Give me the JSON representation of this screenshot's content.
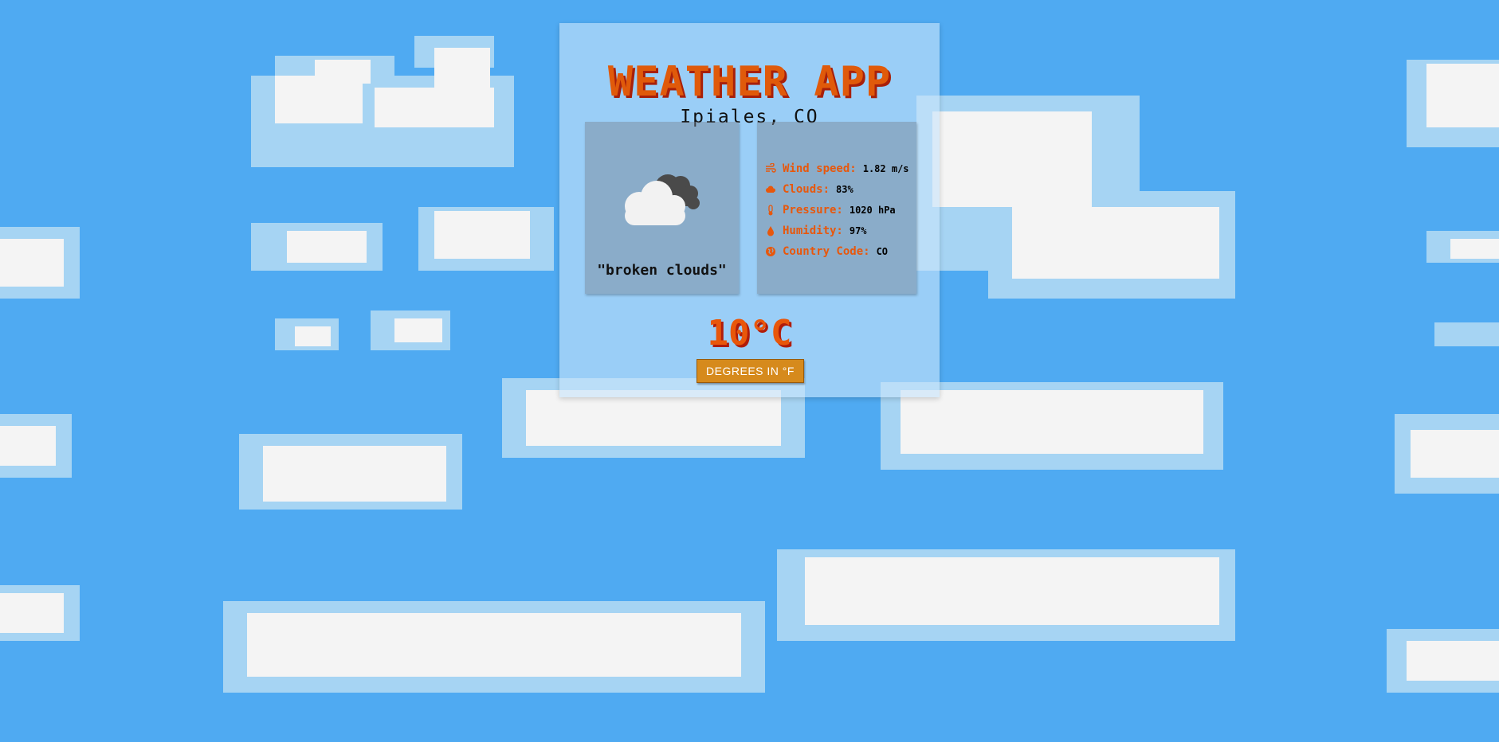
{
  "app": {
    "title": "WEATHER APP",
    "location": "Ipiales, CO"
  },
  "weather": {
    "description": "\"broken clouds\"",
    "icon": "broken-clouds-icon"
  },
  "stats": [
    {
      "icon": "wind-icon",
      "label": "Wind speed:",
      "value": "1.82 m/s"
    },
    {
      "icon": "cloud-icon",
      "label": "Clouds:",
      "value": "83%"
    },
    {
      "icon": "thermometer-icon",
      "label": "Pressure:",
      "value": "1020 hPa"
    },
    {
      "icon": "droplet-icon",
      "label": "Humidity:",
      "value": "97%"
    },
    {
      "icon": "globe-icon",
      "label": "Country Code:",
      "value": "CO"
    }
  ],
  "temperature": {
    "value": "10°C"
  },
  "toggle": {
    "label": "DEGREES IN °F"
  },
  "colors": {
    "sky": "#4faaf2",
    "accent": "#e8570b",
    "button": "#d68a1c"
  }
}
